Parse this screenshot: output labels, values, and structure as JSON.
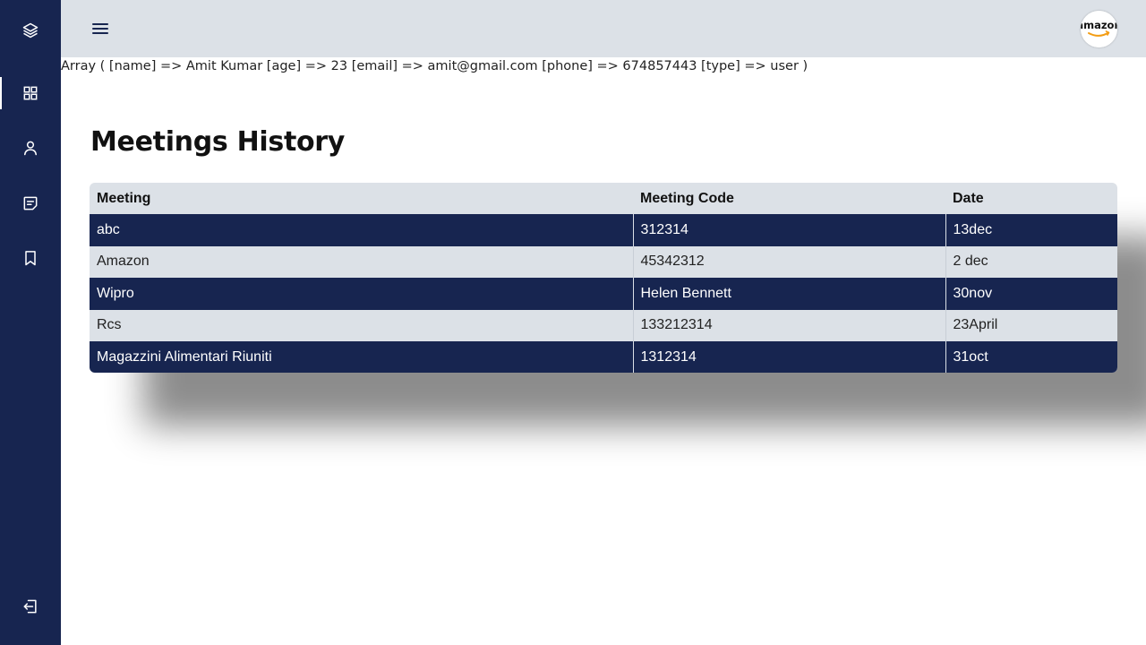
{
  "sidebar": {
    "items": [
      {
        "icon": "layers-icon"
      },
      {
        "icon": "dashboard-grid-icon",
        "active": true
      },
      {
        "icon": "user-icon"
      },
      {
        "icon": "notes-icon"
      },
      {
        "icon": "bookmark-icon"
      }
    ],
    "logout_icon": "logout-icon"
  },
  "topbar": {
    "menu_icon": "hamburger-menu-icon",
    "avatar_text": "amazon"
  },
  "debug_text": "Array ( [name] => Amit Kumar [age] => 23 [email] => amit@gmail.com [phone] => 674857443 [type] => user )",
  "page": {
    "title": "Meetings History"
  },
  "table": {
    "headers": [
      "Meeting",
      "Meeting Code",
      "Date"
    ],
    "rows": [
      [
        "abc",
        "312314",
        "13dec"
      ],
      [
        "Amazon",
        "45342312",
        "2 dec"
      ],
      [
        "Wipro",
        "Helen Bennett",
        "30nov"
      ],
      [
        "Rcs",
        "133212314",
        "23April"
      ],
      [
        "Magazzini Alimentari Riuniti",
        "1312314",
        "31oct"
      ]
    ]
  },
  "colors": {
    "sidebar": "#172550",
    "topbar": "#dce1e7",
    "row_dark": "#172550",
    "row_light": "#dce1e7"
  }
}
